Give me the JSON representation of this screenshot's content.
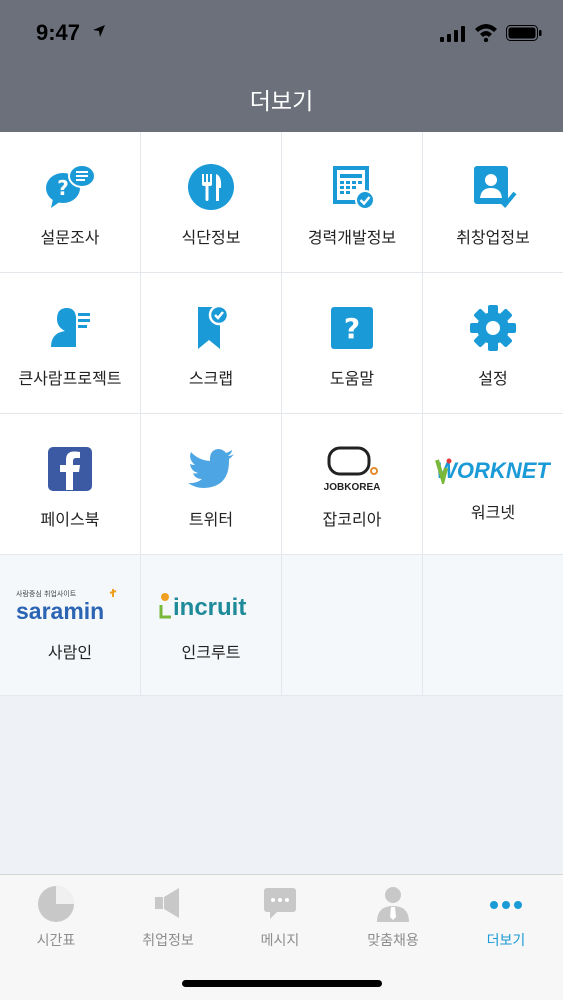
{
  "status_bar": {
    "time": "9:47"
  },
  "header": {
    "title": "더보기"
  },
  "menu": [
    {
      "label": "설문조사"
    },
    {
      "label": "식단정보"
    },
    {
      "label": "경력개발정보"
    },
    {
      "label": "취창업정보"
    },
    {
      "label": "큰사람프로젝트"
    },
    {
      "label": "스크랩"
    },
    {
      "label": "도움말"
    },
    {
      "label": "설정"
    },
    {
      "label": "페이스북"
    },
    {
      "label": "트위터"
    },
    {
      "label": "잡코리아",
      "logo_text": "JOBKOREA"
    },
    {
      "label": "워크넷",
      "logo_text": "WORKNET"
    },
    {
      "label": "사람인",
      "logo_text": "saramin",
      "logo_subtext": "사람중심 취업사이트"
    },
    {
      "label": "인크루트",
      "logo_text": "incruit"
    }
  ],
  "tabs": [
    {
      "label": "시간표"
    },
    {
      "label": "취업정보"
    },
    {
      "label": "메시지"
    },
    {
      "label": "맞춤채용"
    },
    {
      "label": "더보기"
    }
  ],
  "colors": {
    "accent": "#1a9ad6",
    "header_bg": "#6b707a",
    "inactive": "#8d8d8d"
  }
}
